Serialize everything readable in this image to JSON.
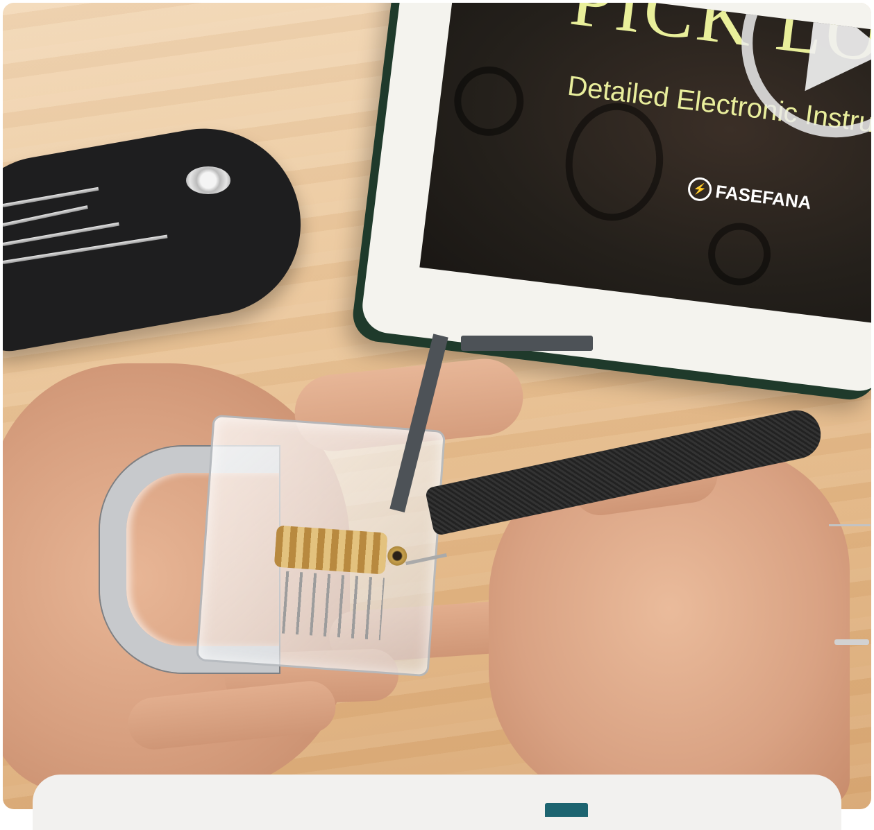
{
  "photo": {
    "tablet": {
      "title": "PICK LO",
      "subtitle": "Detailed Electronic Instruct",
      "brand": "FASEFANA",
      "play_icon": "play-icon"
    },
    "bottom_card": {
      "icon": "card-icon"
    }
  }
}
